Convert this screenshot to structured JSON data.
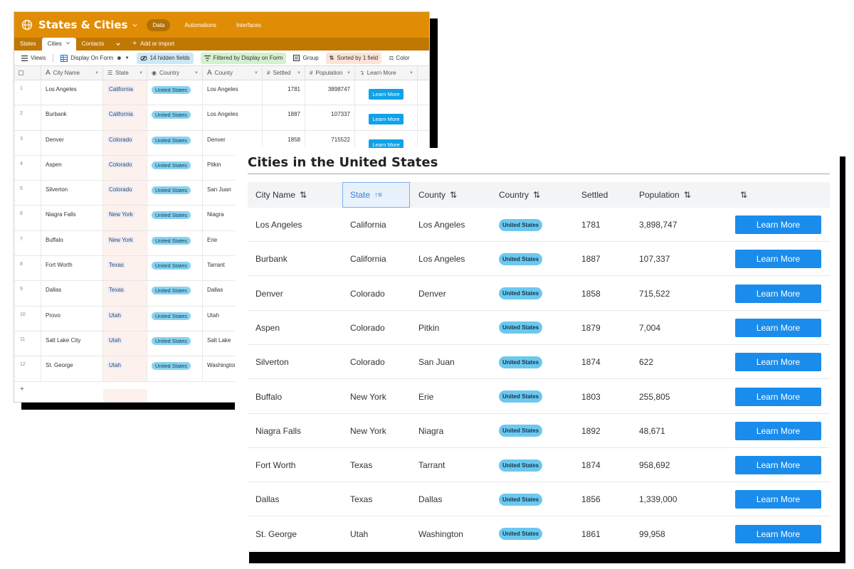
{
  "back": {
    "app_title": "States & Cities",
    "nav": [
      "Data",
      "Automations",
      "Interfaces"
    ],
    "tabs": [
      "States",
      "Cities",
      "Contacts"
    ],
    "add_import": "Add or import",
    "toolbar": {
      "views": "Views",
      "view_name": "Display On Form",
      "hidden": "14 hidden fields",
      "filter": "Filtered by Display on Form",
      "group": "Group",
      "sort": "Sorted by 1 field",
      "color": "Color"
    },
    "colors": {
      "app_bar": "#e08d05",
      "tab_bar": "#c07703",
      "hidden_chip": "#cde7f8",
      "filter_chip": "#d4f0cf",
      "sort_chip": "#fde2d8"
    },
    "columns": [
      "City Name",
      "State",
      "Country",
      "County",
      "Settled",
      "Population",
      "Learn More"
    ],
    "learn_label": "Learn More",
    "rows": [
      {
        "n": "1",
        "city": "Los Angeles",
        "state": "California",
        "country": "United States",
        "county": "Los Angeles",
        "settled": "1781",
        "pop": "3898747"
      },
      {
        "n": "2",
        "city": "Burbank",
        "state": "California",
        "country": "United States",
        "county": "Los Angeles",
        "settled": "1887",
        "pop": "107337"
      },
      {
        "n": "3",
        "city": "Denver",
        "state": "Colorado",
        "country": "United States",
        "county": "Denver",
        "settled": "1858",
        "pop": "715522"
      },
      {
        "n": "4",
        "city": "Aspen",
        "state": "Colorado",
        "country": "United States",
        "county": "Pitkin",
        "settled": "",
        "pop": ""
      },
      {
        "n": "5",
        "city": "Silverton",
        "state": "Colorado",
        "country": "United States",
        "county": "San Juan",
        "settled": "",
        "pop": ""
      },
      {
        "n": "6",
        "city": "Niagra Falls",
        "state": "New York",
        "country": "United States",
        "county": "Niagra",
        "settled": "",
        "pop": ""
      },
      {
        "n": "7",
        "city": "Buffalo",
        "state": "New York",
        "country": "United States",
        "county": "Erie",
        "settled": "",
        "pop": ""
      },
      {
        "n": "8",
        "city": "Fort Worth",
        "state": "Texas",
        "country": "United States",
        "county": "Tarrant",
        "settled": "",
        "pop": ""
      },
      {
        "n": "9",
        "city": "Dallas",
        "state": "Texas",
        "country": "United States",
        "county": "Dallas",
        "settled": "",
        "pop": ""
      },
      {
        "n": "10",
        "city": "Provo",
        "state": "Utah",
        "country": "United States",
        "county": "Utah",
        "settled": "",
        "pop": ""
      },
      {
        "n": "11",
        "city": "Salt Lake City",
        "state": "Utah",
        "country": "United States",
        "county": "Salt Lake",
        "settled": "",
        "pop": ""
      },
      {
        "n": "12",
        "city": "St. George",
        "state": "Utah",
        "country": "United States",
        "county": "Washington",
        "settled": "",
        "pop": ""
      }
    ],
    "add_row": "+"
  },
  "front": {
    "title": "Cities in the United States",
    "columns": [
      "City Name",
      "State",
      "County",
      "Country",
      "Settled",
      "Population"
    ],
    "button_label": "Learn More",
    "button_color": "#1a8cec",
    "rows": [
      {
        "city": "Los Angeles",
        "state": "California",
        "county": "Los Angeles",
        "country": "United States",
        "settled": "1781",
        "pop": "3,898,747"
      },
      {
        "city": "Burbank",
        "state": "California",
        "county": "Los Angeles",
        "country": "United States",
        "settled": "1887",
        "pop": "107,337"
      },
      {
        "city": "Denver",
        "state": "Colorado",
        "county": "Denver",
        "country": "United States",
        "settled": "1858",
        "pop": "715,522"
      },
      {
        "city": "Aspen",
        "state": "Colorado",
        "county": "Pitkin",
        "country": "United States",
        "settled": "1879",
        "pop": "7,004"
      },
      {
        "city": "Silverton",
        "state": "Colorado",
        "county": "San Juan",
        "country": "United States",
        "settled": "1874",
        "pop": "622"
      },
      {
        "city": "Buffalo",
        "state": "New York",
        "county": "Erie",
        "country": "United States",
        "settled": "1803",
        "pop": "255,805"
      },
      {
        "city": "Niagra Falls",
        "state": "New York",
        "county": "Niagra",
        "country": "United States",
        "settled": "1892",
        "pop": "48,671"
      },
      {
        "city": "Fort Worth",
        "state": "Texas",
        "county": "Tarrant",
        "country": "United States",
        "settled": "1874",
        "pop": "958,692"
      },
      {
        "city": "Dallas",
        "state": "Texas",
        "county": "Dallas",
        "country": "United States",
        "settled": "1856",
        "pop": "1,339,000"
      },
      {
        "city": "St. George",
        "state": "Utah",
        "county": "Washington",
        "country": "United States",
        "settled": "1861",
        "pop": "99,958"
      }
    ]
  }
}
